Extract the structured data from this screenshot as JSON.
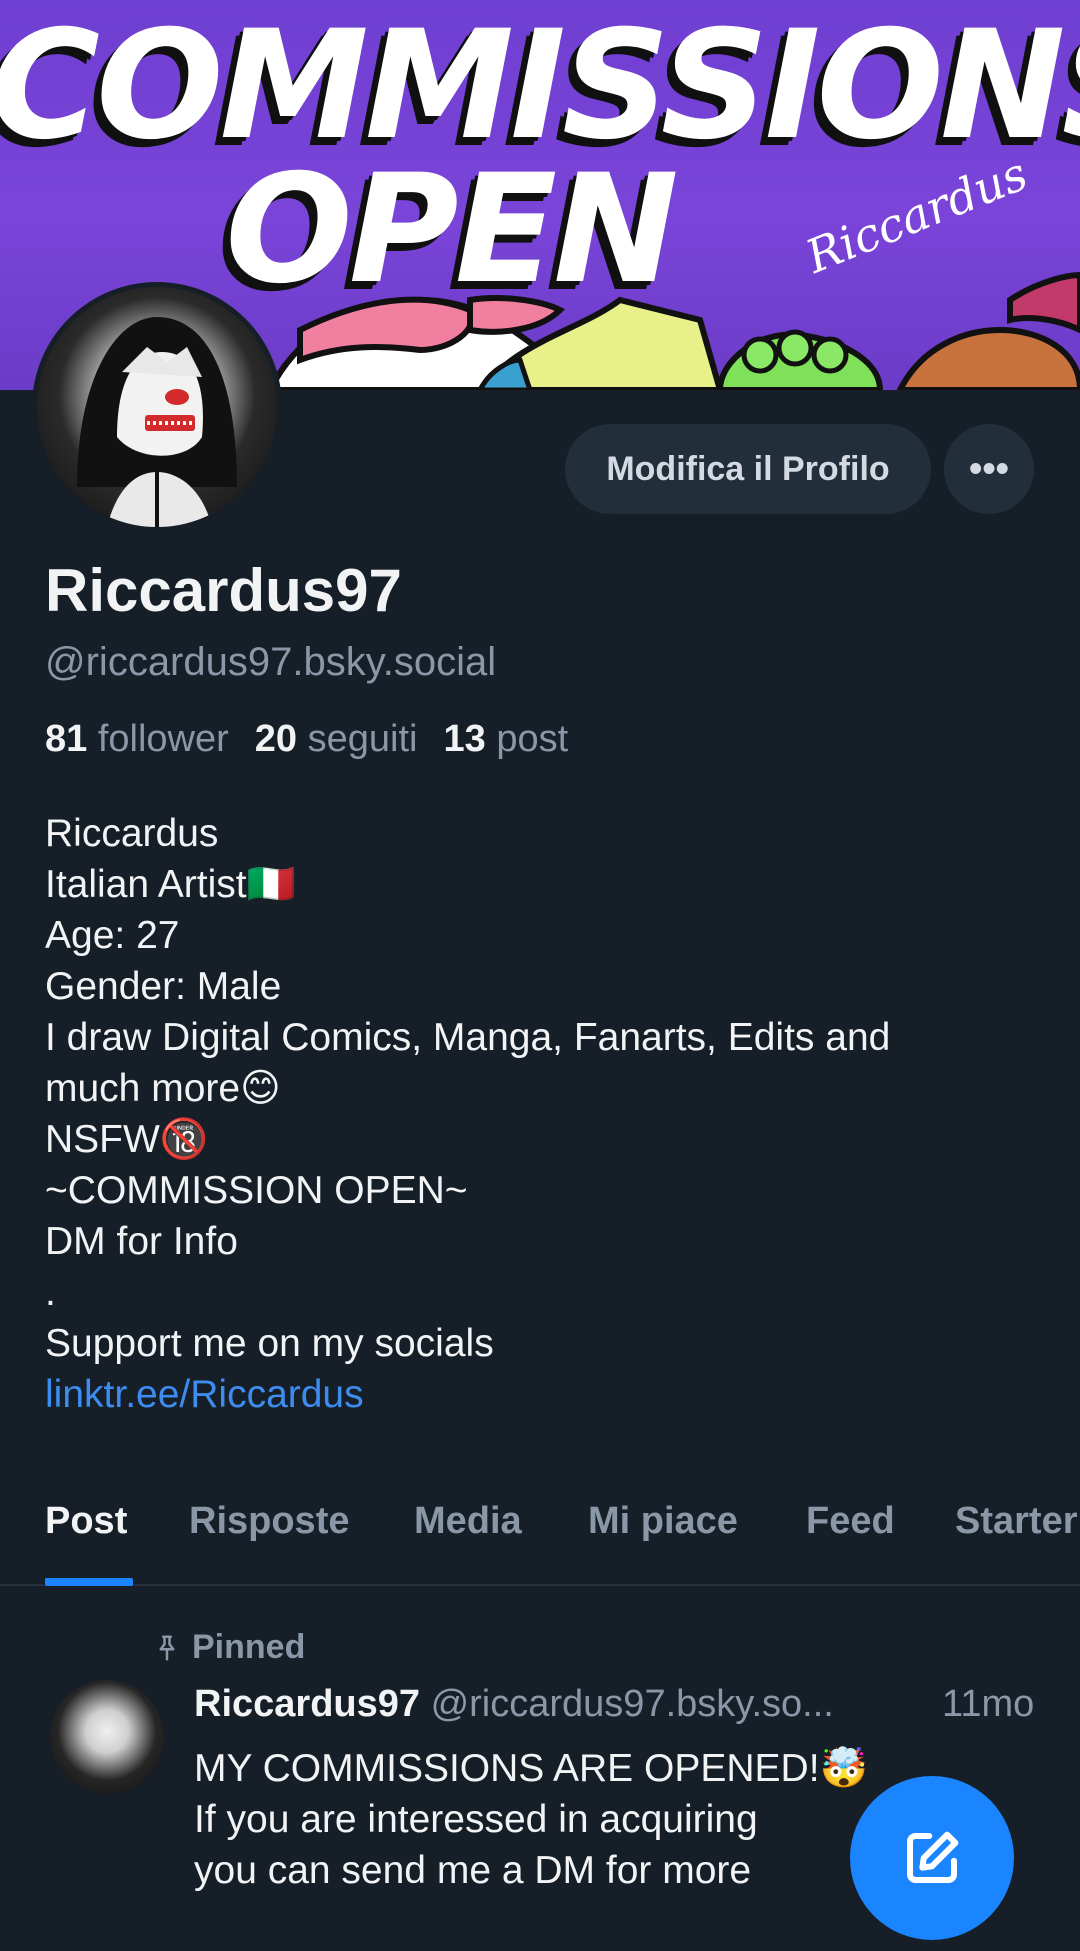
{
  "banner": {
    "line1": "COMMISSIONS",
    "line2": "OPEN",
    "signature": "Riccardus"
  },
  "profile": {
    "edit_button": "Modifica il Profilo",
    "more_button": "•••",
    "display_name": "Riccardus97",
    "handle": "@riccardus97.bsky.social",
    "stats": {
      "followers_count": "81",
      "followers_label": "follower",
      "following_count": "20",
      "following_label": "seguiti",
      "posts_count": "13",
      "posts_label": "post"
    },
    "bio": [
      "Riccardus",
      "Italian Artist🇮🇹",
      "Age: 27",
      "Gender: Male",
      "I draw Digital Comics, Manga, Fanarts, Edits and",
      "much more😊",
      "NSFW🔞",
      "~COMMISSION OPEN~",
      "DM for Info",
      ".",
      "Support me on my socials"
    ],
    "link": "linktr.ee/Riccardus"
  },
  "tabs": [
    {
      "label": "Post",
      "active": true
    },
    {
      "label": "Risposte",
      "active": false
    },
    {
      "label": "Media",
      "active": false
    },
    {
      "label": "Mi piace",
      "active": false
    },
    {
      "label": "Feed",
      "active": false
    },
    {
      "label": "Starter",
      "active": false
    }
  ],
  "post": {
    "pinned_label": "Pinned",
    "author": "Riccardus97",
    "handle": "@riccardus97.bsky.so...",
    "time": "11mo",
    "lines": [
      "MY COMMISSIONS ARE OPENED!🤯",
      "If you are interessed in acquiring",
      "you can send me a DM for more"
    ]
  },
  "colors": {
    "background": "#161e27",
    "accent": "#1a85ff",
    "link": "#3d8cf0",
    "muted": "#8a97a6",
    "banner": "#7a44d8"
  },
  "icons": {
    "pin": "pin-icon",
    "compose": "compose-icon"
  }
}
